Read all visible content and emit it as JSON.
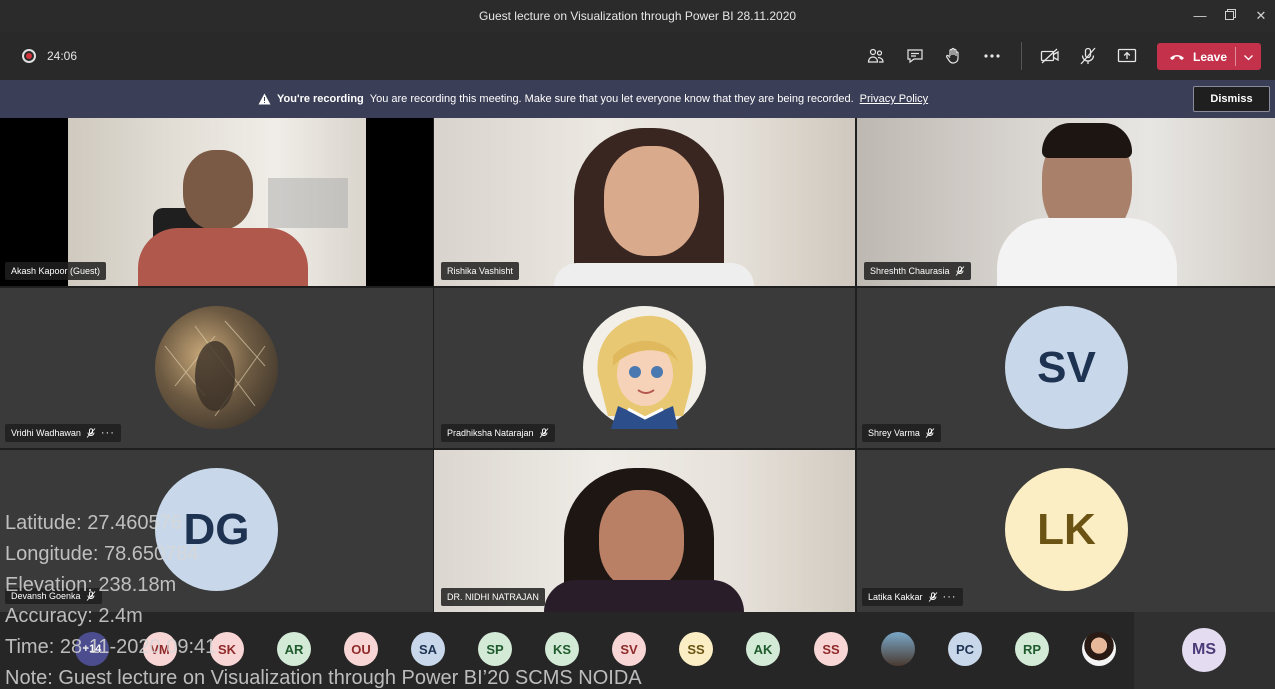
{
  "window": {
    "title": "Guest lecture on Visualization through Power BI 28.11.2020"
  },
  "toolbar": {
    "timer": "24:06",
    "leave_label": "Leave"
  },
  "banner": {
    "title": "You're recording",
    "message": "You are recording this meeting. Make sure that you let everyone know that they are being recorded.",
    "link": "Privacy Policy",
    "dismiss": "Dismiss"
  },
  "participants": {
    "p1": "Akash Kapoor (Guest)",
    "p2": "Rishika Vashisht",
    "p3": "Shreshth Chaurasia",
    "p4": "Vridhi Wadhawan",
    "p5": "Pradhiksha Natarajan",
    "p6": "Shrey Varma",
    "p6_initials": "SV",
    "p7": "Devansh Goenka",
    "p7_initials": "DG",
    "p8": "DR. NIDHI NATRAJAN",
    "p9": "Latika Kakkar",
    "p9_initials": "LK"
  },
  "roster": {
    "overflow": "+14",
    "items": [
      "VM",
      "SK",
      "AR",
      "OU",
      "SA",
      "SP",
      "KS",
      "SV",
      "SS",
      "AK",
      "SS",
      "PC",
      "RP"
    ],
    "self": "MS"
  },
  "overlay": {
    "latitude": "Latitude: 27.460576",
    "longitude": "Longitude: 78.650784",
    "elevation": "Elevation: 238.18m",
    "accuracy": "Accuracy: 2.4m",
    "time": "Time: 28-11-2020  09:41",
    "note": "Note: Guest lecture on Visualization through Power BI’20 SCMS NOIDA"
  },
  "colors": {
    "leave": "#c4314b",
    "banner": "#3b3e57",
    "sv_avatar": "#c8d8ea",
    "lk_avatar": "#fbeec4"
  }
}
